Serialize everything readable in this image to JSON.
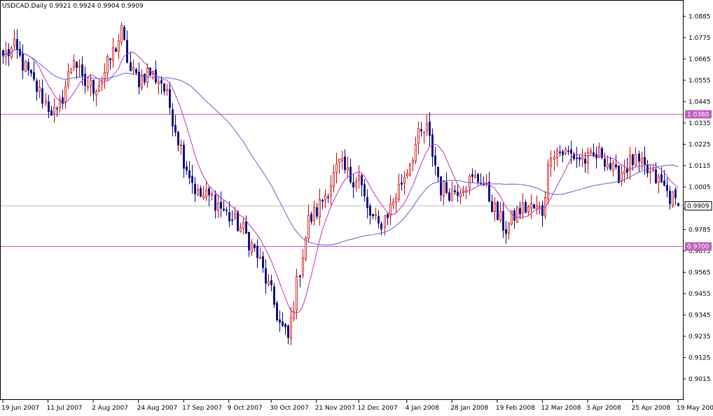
{
  "chart_data": {
    "type": "candlestick",
    "symbol": "USDCAD",
    "timeframe": "Daily",
    "header": "USDCAD,Daily  0.9921 0.9924 0.9904 0.9909",
    "ohlc_last": {
      "open": 0.9921,
      "high": 0.9924,
      "low": 0.9904,
      "close": 0.9909
    },
    "ylim": [
      0.9015,
      1.094
    ],
    "y_ticks": [
      "1.0885",
      "1.0775",
      "1.0665",
      "1.0555",
      "1.0445",
      "1.0335",
      "1.0225",
      "1.0115",
      "1.0005",
      "0.9895",
      "0.9785",
      "0.9675",
      "0.9565",
      "0.9455",
      "0.9345",
      "0.9235",
      "0.9125",
      "0.9015"
    ],
    "x_ticks": [
      "19 Jun 2007",
      "11 Jul 2007",
      "2 Aug 2007",
      "24 Aug 2007",
      "17 Sep 2007",
      "9 Oct 2007",
      "30 Oct 2007",
      "21 Nov 2007",
      "12 Dec 2007",
      "4 Jan 2008",
      "28 Jan 2008",
      "19 Feb 2008",
      "12 Mar 2008",
      "3 Apr 2008",
      "25 Apr 2008",
      "19 May 2008"
    ],
    "horizontal_lines": [
      {
        "value": 1.038,
        "label": "1.0380",
        "color": "#bf5fbf"
      },
      {
        "value": 0.97,
        "label": "0.9700",
        "color": "#bf5fbf"
      }
    ],
    "current_price": {
      "value": 0.9909,
      "label": "0.9909"
    },
    "colors": {
      "bull": "#d40000",
      "bear": "#00007f",
      "ma_fast": "#c030c0",
      "ma_slow": "#6060d0",
      "hline": "#bf5fbf",
      "price_line": "#c0c0c0"
    },
    "key_points": [
      {
        "date": "19 Jun 2007",
        "close": 1.068
      },
      {
        "date": "25 Jun 2007",
        "close": 1.072
      },
      {
        "date": "3 Jul 2007",
        "close": 1.056
      },
      {
        "date": "11 Jul 2007",
        "close": 1.042
      },
      {
        "date": "16 Jul 2007",
        "close": 1.037
      },
      {
        "date": "24 Jul 2007",
        "close": 1.068
      },
      {
        "date": "27 Jul 2007",
        "close": 1.054
      },
      {
        "date": "2 Aug 2007",
        "close": 1.052
      },
      {
        "date": "7 Aug 2007",
        "close": 1.056
      },
      {
        "date": "16 Aug 2007",
        "close": 1.08
      },
      {
        "date": "21 Aug 2007",
        "close": 1.06
      },
      {
        "date": "24 Aug 2007",
        "close": 1.056
      },
      {
        "date": "29 Aug 2007",
        "close": 1.06
      },
      {
        "date": "5 Sep 2007",
        "close": 1.055
      },
      {
        "date": "10 Sep 2007",
        "close": 1.042
      },
      {
        "date": "17 Sep 2007",
        "close": 1.015
      },
      {
        "date": "24 Sep 2007",
        "close": 0.996
      },
      {
        "date": "1 Oct 2007",
        "close": 0.995
      },
      {
        "date": "9 Oct 2007",
        "close": 0.985
      },
      {
        "date": "16 Oct 2007",
        "close": 0.978
      },
      {
        "date": "23 Oct 2007",
        "close": 0.965
      },
      {
        "date": "30 Oct 2007",
        "close": 0.945
      },
      {
        "date": "2 Nov 2007",
        "close": 0.93
      },
      {
        "date": "7 Nov 2007",
        "close": 0.922
      },
      {
        "date": "12 Nov 2007",
        "close": 0.95
      },
      {
        "date": "16 Nov 2007",
        "close": 0.983
      },
      {
        "date": "21 Nov 2007",
        "close": 0.988
      },
      {
        "date": "27 Nov 2007",
        "close": 1.0
      },
      {
        "date": "3 Dec 2007",
        "close": 1.012
      },
      {
        "date": "7 Dec 2007",
        "close": 1.005
      },
      {
        "date": "12 Dec 2007",
        "close": 1.006
      },
      {
        "date": "17 Dec 2007",
        "close": 0.988
      },
      {
        "date": "21 Dec 2007",
        "close": 0.98
      },
      {
        "date": "27 Dec 2007",
        "close": 0.99
      },
      {
        "date": "4 Jan 2008",
        "close": 1.01
      },
      {
        "date": "10 Jan 2008",
        "close": 1.026
      },
      {
        "date": "15 Jan 2008",
        "close": 1.03
      },
      {
        "date": "22 Jan 2008",
        "close": 1.0
      },
      {
        "date": "28 Jan 2008",
        "close": 0.998
      },
      {
        "date": "4 Feb 2008",
        "close": 1.003
      },
      {
        "date": "11 Feb 2008",
        "close": 1.005
      },
      {
        "date": "19 Feb 2008",
        "close": 0.985
      },
      {
        "date": "22 Feb 2008",
        "close": 0.979
      },
      {
        "date": "28 Feb 2008",
        "close": 0.988
      },
      {
        "date": "5 Mar 2008",
        "close": 0.99
      },
      {
        "date": "12 Mar 2008",
        "close": 0.988
      },
      {
        "date": "17 Mar 2008",
        "close": 1.02
      },
      {
        "date": "24 Mar 2008",
        "close": 1.018
      },
      {
        "date": "3 Apr 2008",
        "close": 1.014
      },
      {
        "date": "10 Apr 2008",
        "close": 1.018
      },
      {
        "date": "17 Apr 2008",
        "close": 1.006
      },
      {
        "date": "25 Apr 2008",
        "close": 1.014
      },
      {
        "date": "2 May 2008",
        "close": 1.008
      },
      {
        "date": "9 May 2008",
        "close": 1.002
      },
      {
        "date": "15 May 2008",
        "close": 0.994
      },
      {
        "date": "19 May 2008",
        "close": 0.9909
      }
    ]
  }
}
